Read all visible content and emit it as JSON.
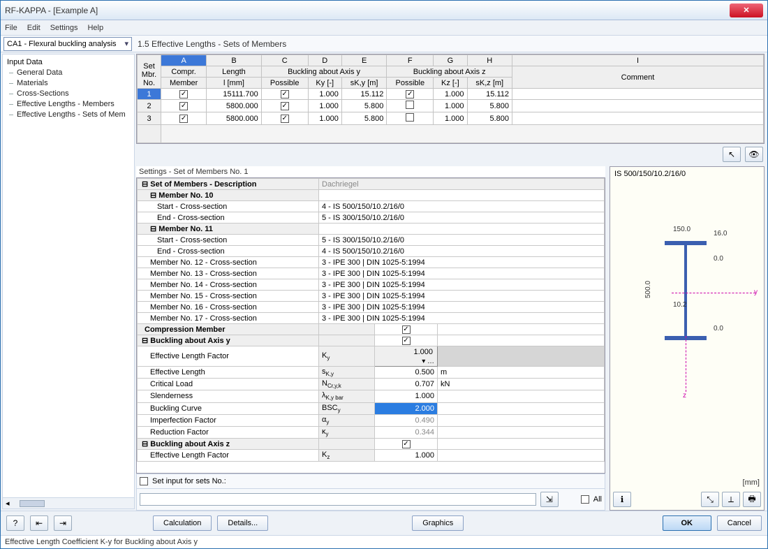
{
  "window": {
    "title": "RF-KAPPA - [Example A]"
  },
  "menus": {
    "file": "File",
    "edit": "Edit",
    "settings": "Settings",
    "help": "Help"
  },
  "load_case": "CA1 - Flexural buckling analysis",
  "section_title": "1.5 Effective Lengths - Sets of Members",
  "tree": {
    "root": "Input Data",
    "items": [
      "General Data",
      "Materials",
      "Cross-Sections",
      "Effective Lengths - Members",
      "Effective Lengths - Sets of Mem"
    ]
  },
  "grid": {
    "col_letters": [
      "A",
      "B",
      "C",
      "D",
      "E",
      "F",
      "G",
      "H",
      "I"
    ],
    "head1": {
      "set": "Set Mbr.",
      "compr": "Compr.",
      "length": "Length",
      "buck_y": "Buckling about Axis y",
      "buck_z": "Buckling about Axis z",
      "comment": "Comment"
    },
    "head2": {
      "no": "No.",
      "member": "Member",
      "l": "l [mm]",
      "possible": "Possible",
      "ky": "Ky [-]",
      "sky": "sK,y [m]",
      "kz": "Kz [-]",
      "skz": "sK,z [m]"
    },
    "rows": [
      {
        "no": "1",
        "compr": true,
        "l": "15111.700",
        "possy": true,
        "ky": "1.000",
        "sky": "15.112",
        "possz": true,
        "kz": "1.000",
        "skz": "15.112",
        "comment": ""
      },
      {
        "no": "2",
        "compr": true,
        "l": "5800.000",
        "possy": true,
        "ky": "1.000",
        "sky": "5.800",
        "possz": false,
        "kz": "1.000",
        "skz": "5.800",
        "comment": ""
      },
      {
        "no": "3",
        "compr": true,
        "l": "5800.000",
        "possy": true,
        "ky": "1.000",
        "sky": "5.800",
        "possz": false,
        "kz": "1.000",
        "skz": "5.800",
        "comment": ""
      }
    ]
  },
  "settings": {
    "title": "Settings  -  Set of Members No.  1",
    "desc_label": "Set of Members - Description",
    "desc_value": "Dachriegel",
    "members": [
      {
        "label": "Member No. 10",
        "start": "Start - Cross-section",
        "start_val": "4 - IS 500/150/10.2/16/0",
        "end": "End - Cross-section",
        "end_val": "5 - IS 300/150/10.2/16/0"
      },
      {
        "label": "Member No. 11",
        "start": "Start - Cross-section",
        "start_val": "5 - IS 300/150/10.2/16/0",
        "end": "End - Cross-section",
        "end_val": "4 - IS 500/150/10.2/16/0"
      }
    ],
    "simple_members": [
      {
        "label": "Member No. 12 - Cross-section",
        "val": "3 - IPE 300 | DIN 1025-5:1994"
      },
      {
        "label": "Member No. 13 - Cross-section",
        "val": "3 - IPE 300 | DIN 1025-5:1994"
      },
      {
        "label": "Member No. 14 - Cross-section",
        "val": "3 - IPE 300 | DIN 1025-5:1994"
      },
      {
        "label": "Member No. 15 - Cross-section",
        "val": "3 - IPE 300 | DIN 1025-5:1994"
      },
      {
        "label": "Member No. 16 - Cross-section",
        "val": "3 - IPE 300 | DIN 1025-5:1994"
      },
      {
        "label": "Member No. 17 - Cross-section",
        "val": "3 - IPE 300 | DIN 1025-5:1994"
      }
    ],
    "compression_label": "Compression Member",
    "buck_y_label": "Buckling about Axis y",
    "buck_y": {
      "elf": {
        "lbl": "Effective Length Factor",
        "sym": "Ky",
        "val": "1.000"
      },
      "el": {
        "lbl": "Effective Length",
        "sym": "sK,y",
        "val": "0.500",
        "unit": "m"
      },
      "cl": {
        "lbl": "Critical Load",
        "sym": "NCr,y,k",
        "val": "0.707",
        "unit": "kN"
      },
      "sl": {
        "lbl": "Slenderness",
        "sym": "λK,y bar",
        "val": "1.000"
      },
      "bc": {
        "lbl": "Buckling Curve",
        "sym": "BSCy",
        "val": "2.000"
      },
      "if": {
        "lbl": "Imperfection Factor",
        "sym": "αy",
        "val": "0.490"
      },
      "rf": {
        "lbl": "Reduction Factor",
        "sym": "κy",
        "val": "0.344"
      }
    },
    "buck_z_label": "Buckling about Axis z",
    "buck_z": {
      "elf": {
        "lbl": "Effective Length Factor",
        "sym": "Kz",
        "val": "1.000"
      }
    },
    "set_input": "Set input for sets No.:",
    "all": "All"
  },
  "preview": {
    "title": "IS 500/150/10.2/16/0",
    "d150": "150.0",
    "d16": "16.0",
    "d500": "500.0",
    "d102": "10.2",
    "d00a": "0.0",
    "d00b": "0.0",
    "unit": "[mm]",
    "y": "y",
    "z": "z"
  },
  "footer": {
    "calc": "Calculation",
    "details": "Details...",
    "graphics": "Graphics",
    "ok": "OK",
    "cancel": "Cancel"
  },
  "status": "Effective Length Coefficient K-y for Buckling about Axis y"
}
